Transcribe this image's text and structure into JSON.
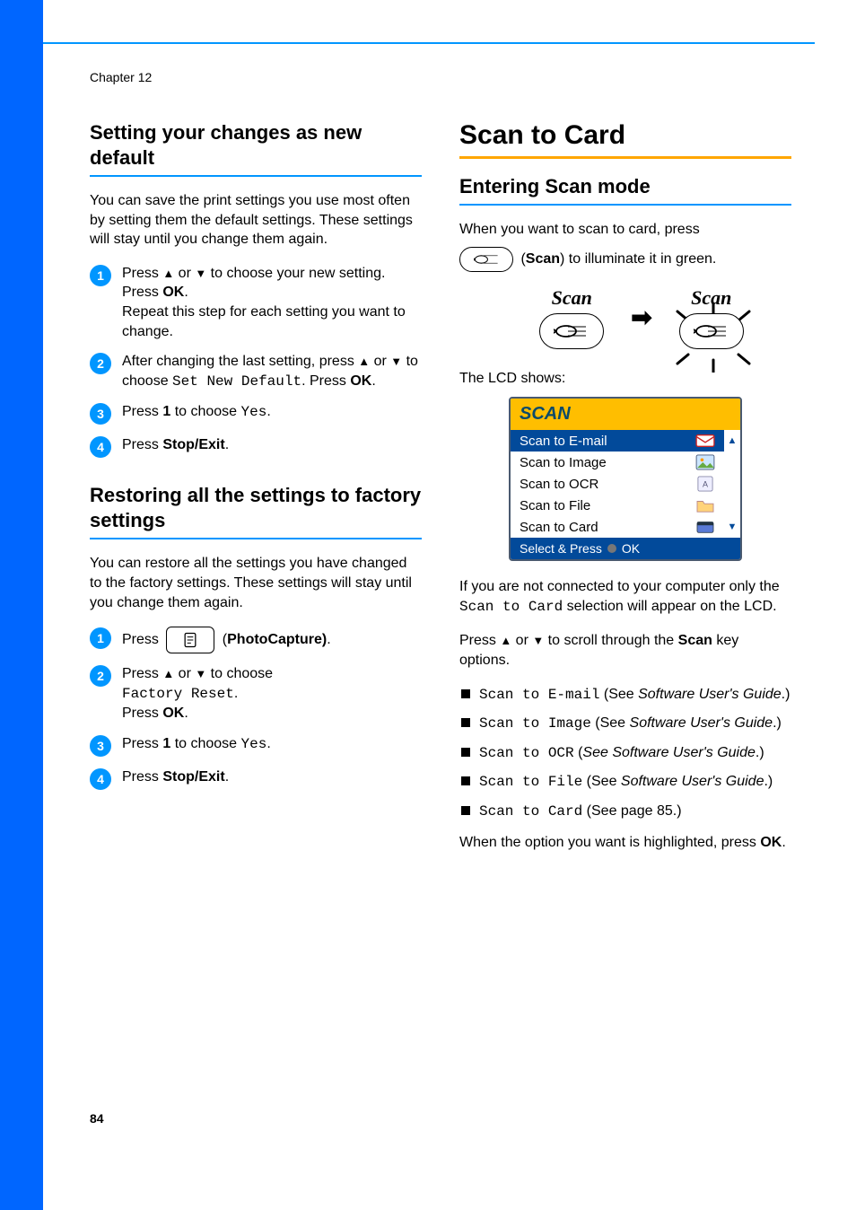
{
  "chapter": "Chapter 12",
  "page_number": "84",
  "left": {
    "h1": "Setting your changes as new default",
    "p1": "You can save the print settings you use most often by setting them the default settings. These settings will stay until you change them again.",
    "step1_a": "Press ",
    "step1_b": " or ",
    "step1_c": " to choose your new setting.",
    "step1_d": "Press ",
    "step1_ok": "OK",
    "step1_e": ".",
    "step1_f": "Repeat this step for each setting you want to change.",
    "step2_a": "After changing the last setting,  press ",
    "step2_b": " or ",
    "step2_c": " to choose ",
    "step2_mono": "Set New Default",
    "step2_d": ". Press ",
    "step2_ok": "OK",
    "step2_e": ".",
    "step3_a": "Press ",
    "step3_bold": "1",
    "step3_b": " to choose ",
    "step3_mono": "Yes",
    "step3_c": ".",
    "step4_a": "Press ",
    "step4_bold": "Stop/Exit",
    "step4_b": ".",
    "h2": "Restoring all the settings to factory settings",
    "p2": "You can restore all the settings you have changed to the factory settings. These settings will stay until you change them again.",
    "r1_a": "Press ",
    "r1_b": " (",
    "r1_bold": "PhotoCapture)",
    "r1_c": ".",
    "r2_a": "Press ",
    "r2_b": " or ",
    "r2_c": " to choose ",
    "r2_mono": "Factory Reset",
    "r2_d": ".",
    "r2_e": "Press ",
    "r2_ok": "OK",
    "r2_f": ".",
    "r3_a": "Press ",
    "r3_bold": "1",
    "r3_b": " to choose ",
    "r3_mono": "Yes",
    "r3_c": ".",
    "r4_a": "Press ",
    "r4_bold": "Stop/Exit",
    "r4_b": "."
  },
  "right": {
    "h1": "Scan to Card",
    "h2": "Entering Scan mode",
    "p1_a": "When you want to scan to card, press",
    "p1_b": " (",
    "p1_bold": "Scan",
    "p1_c": ") to illuminate it in green.",
    "scan_label": "Scan",
    "lcd_intro": "The LCD shows:",
    "lcd": {
      "title": "SCAN",
      "items": [
        "Scan to E-mail",
        "Scan to Image",
        "Scan to OCR",
        "Scan to File",
        "Scan to Card"
      ],
      "footer_a": "Select & Press",
      "footer_b": "OK"
    },
    "p2_a": "If you are not connected to your computer only the ",
    "p2_mono": "Scan to Card",
    "p2_b": " selection will appear on the LCD.",
    "p3_a": "Press ",
    "p3_b": " or ",
    "p3_c": " to scroll through the ",
    "p3_bold": "Scan",
    "p3_d": " key options.",
    "list": [
      {
        "mono": "Scan to E-mail",
        "mid": " (See ",
        "ital": "Software User's Guide",
        "end": ".)"
      },
      {
        "mono": "Scan to Image",
        "mid": " (See ",
        "ital": "Software User's Guide",
        "end": ".)"
      },
      {
        "mono": "Scan to OCR",
        "mid": " (",
        "ital": "See Software User's Guide",
        "end": ".)"
      },
      {
        "mono": "Scan to File",
        "mid": " (See ",
        "ital": "Software User's Guide",
        "end": ".)"
      },
      {
        "mono": "Scan to Card",
        "mid": " (See page 85.)",
        "ital": "",
        "end": ""
      }
    ],
    "p4_a": "When the option you want is highlighted, press ",
    "p4_bold": "OK",
    "p4_b": "."
  }
}
